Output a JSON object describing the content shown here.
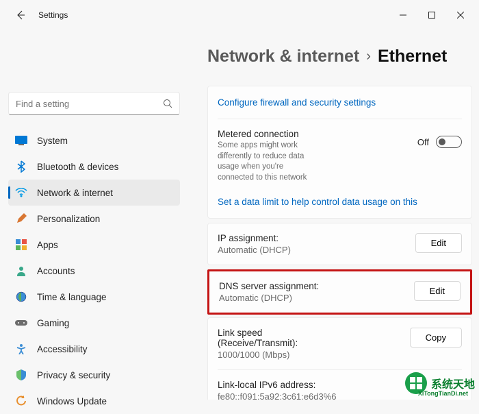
{
  "window": {
    "title": "Settings"
  },
  "search": {
    "placeholder": "Find a setting"
  },
  "sidebar": {
    "items": [
      {
        "label": "System"
      },
      {
        "label": "Bluetooth & devices"
      },
      {
        "label": "Network & internet"
      },
      {
        "label": "Personalization"
      },
      {
        "label": "Apps"
      },
      {
        "label": "Accounts"
      },
      {
        "label": "Time & language"
      },
      {
        "label": "Gaming"
      },
      {
        "label": "Accessibility"
      },
      {
        "label": "Privacy & security"
      },
      {
        "label": "Windows Update"
      }
    ]
  },
  "breadcrumb": {
    "parent": "Network & internet",
    "separator": "›",
    "current": "Ethernet"
  },
  "links": {
    "firewall": "Configure firewall and security settings",
    "data_limit": "Set a data limit to help control data usage on this"
  },
  "metered": {
    "title": "Metered connection",
    "desc": "Some apps might work differently to reduce data usage when you're connected to this network",
    "toggle_label": "Off"
  },
  "ip": {
    "title": "IP assignment:",
    "value": "Automatic (DHCP)",
    "button": "Edit"
  },
  "dns": {
    "title": "DNS server assignment:",
    "value": "Automatic (DHCP)",
    "button": "Edit"
  },
  "linkspeed": {
    "title": "Link speed (Receive/Transmit):",
    "value": "1000/1000 (Mbps)",
    "button": "Copy"
  },
  "ipv6": {
    "title": "Link-local IPv6 address:",
    "value": "fe80::f091:5a92:3c61:e6d3%6"
  },
  "watermark": {
    "text": "系统天地",
    "url": "XiTongTianDi.net"
  }
}
